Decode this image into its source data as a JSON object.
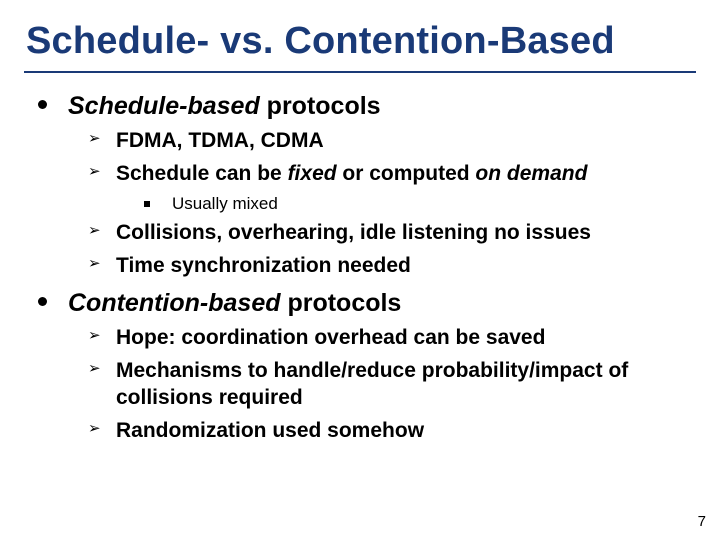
{
  "title": "Schedule- vs. Contention-Based",
  "sections": [
    {
      "heading_italic": "Schedule-based",
      "heading_rest": " protocols",
      "items": [
        {
          "text": "FDMA, TDMA, CDMA"
        },
        {
          "pre": "Schedule can be ",
          "ital1": "fixed",
          "mid": " or computed ",
          "ital2": "on demand",
          "sub": [
            "Usually mixed"
          ]
        },
        {
          "text": "Collisions, overhearing, idle listening no issues"
        },
        {
          "text": "Time synchronization needed"
        }
      ]
    },
    {
      "heading_italic": "Contention-based",
      "heading_rest": " protocols",
      "items": [
        {
          "text": "Hope: coordination overhead can be saved"
        },
        {
          "text": "Mechanisms to handle/reduce probability/impact of collisions required"
        },
        {
          "text": "Randomization used somehow"
        }
      ]
    }
  ],
  "page_number": "7",
  "glyphs": {
    "chevron": "➢"
  }
}
